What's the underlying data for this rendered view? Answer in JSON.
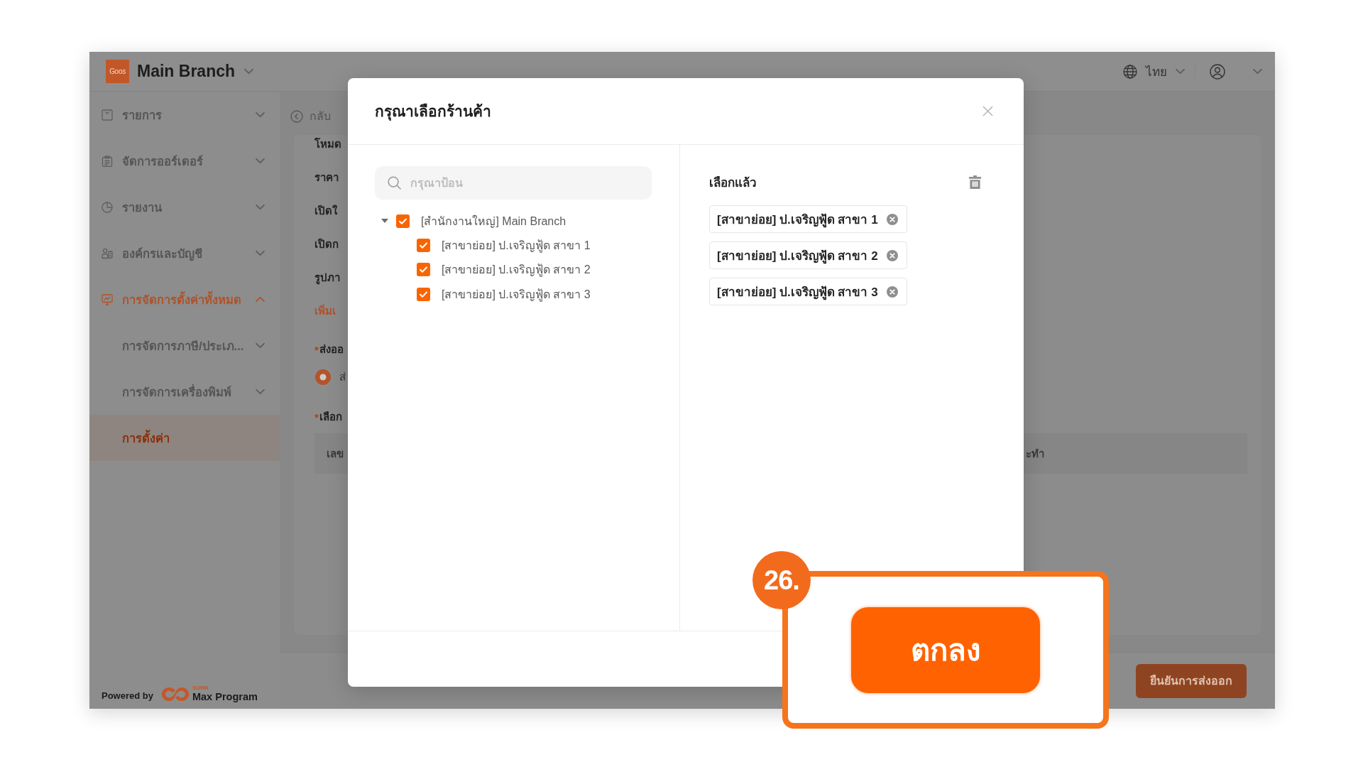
{
  "app": {
    "header": {
      "logo_text": "Goos",
      "branch": "Main Branch",
      "language": "ไทย"
    },
    "sidebar": {
      "items": [
        {
          "label": "รายการ",
          "expanded": false,
          "selected": false
        },
        {
          "label": "จัดการออร์เดอร์",
          "expanded": false,
          "selected": false
        },
        {
          "label": "รายงาน",
          "expanded": false,
          "selected": false
        },
        {
          "label": "องค์กรและบัญชี",
          "expanded": false,
          "selected": false
        },
        {
          "label": "การจัดการตั้งค่าทั้งหมด",
          "expanded": true,
          "selected": false,
          "children": [
            {
              "label": "การจัดการภาษี/ประเภ...",
              "expanded": false,
              "selected": false
            },
            {
              "label": "การจัดการเครื่องพิมพ์",
              "expanded": false,
              "selected": false
            },
            {
              "label": "การตั้งค่า",
              "selected": true
            }
          ]
        }
      ],
      "powered_by": {
        "text": "Powered by",
        "brand_small": "SUNMI",
        "brand": "Max Program"
      }
    },
    "page": {
      "back": "กลับ",
      "rows": [
        {
          "kind": "label",
          "text": "โหมด"
        },
        {
          "kind": "label",
          "text": "ราคา"
        },
        {
          "kind": "label",
          "text": "เปิดใ"
        },
        {
          "kind": "label",
          "text": "เปิดก"
        },
        {
          "kind": "label",
          "text": "รูปภา"
        },
        {
          "kind": "link",
          "text": "เพิ่มเ"
        },
        {
          "kind": "required_label",
          "mark": "*",
          "text": "ส่งออ"
        },
        {
          "kind": "radio",
          "text": "ส่",
          "selected": true
        },
        {
          "kind": "required_label",
          "mark": "*",
          "text": "เลือก"
        },
        {
          "kind": "table_header",
          "columns": [
            "เลข",
            "ะทำ"
          ]
        }
      ],
      "export_button": "ยืนยันการส่งออก"
    }
  },
  "modal": {
    "title": "กรุณาเลือกร้านค้า",
    "search": {
      "placeholder": "กรุณาป้อน"
    },
    "tree": [
      {
        "label": "[สำนักงานใหญ่] Main Branch",
        "checked": true,
        "expanded": true,
        "children": [
          {
            "label": "[สาขาย่อย] ป.เจริญฟู้ด สาขา 1",
            "checked": true
          },
          {
            "label": "[สาขาย่อย] ป.เจริญฟู้ด สาขา 2",
            "checked": true
          },
          {
            "label": "[สาขาย่อย] ป.เจริญฟู้ด สาขา 3",
            "checked": true
          }
        ]
      }
    ],
    "selected_title": "เลือกแล้ว",
    "selected_tags": [
      "[สาขาย่อย] ป.เจริญฟู้ด สาขา 1",
      "[สาขาย่อย] ป.เจริญฟู้ด สาขา 2",
      "[สาขาย่อย] ป.เจริญฟู้ด สาขา 3"
    ]
  },
  "callout": {
    "step": "26.",
    "button": "ตกลง"
  }
}
